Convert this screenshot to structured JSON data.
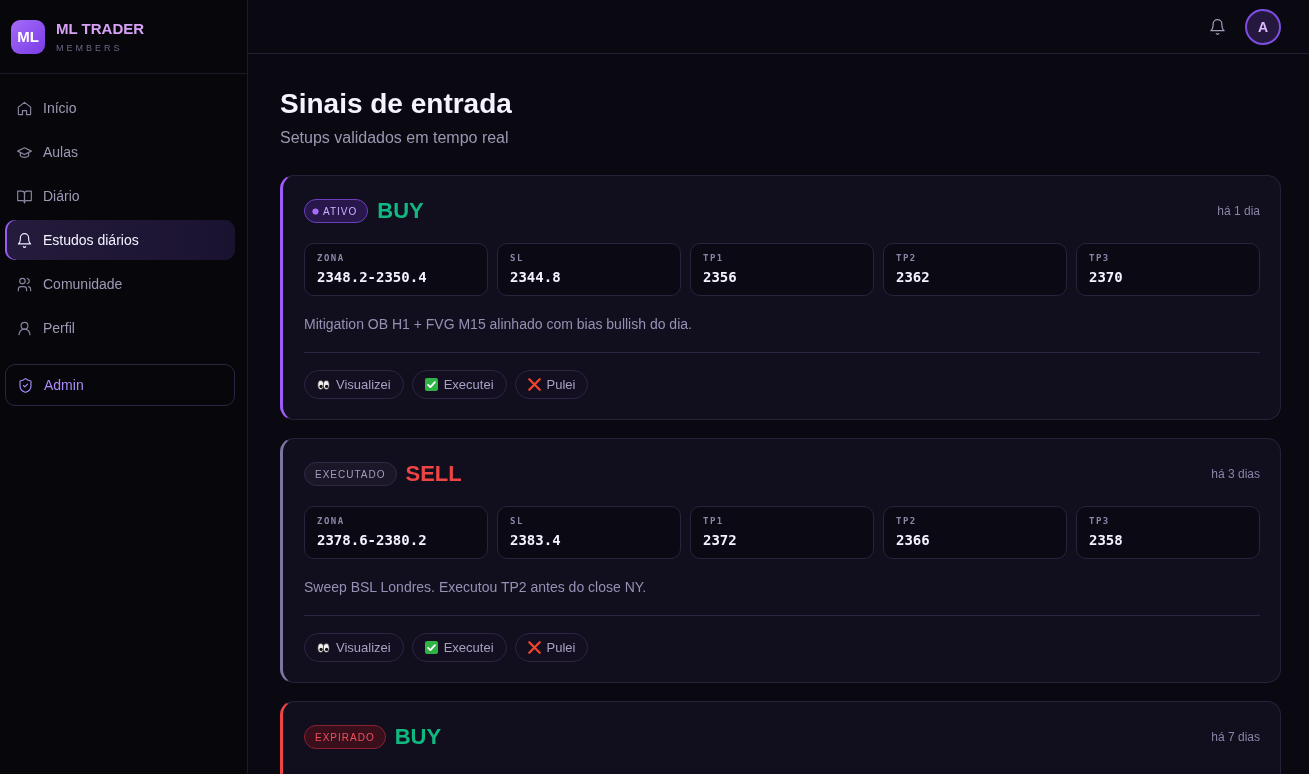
{
  "sidebar": {
    "brand": {
      "logo": "ML",
      "name": "ML TRADER",
      "tagline": "MEMBERS"
    },
    "items": [
      {
        "label": "Início",
        "selected": false
      },
      {
        "label": "Aulas",
        "selected": false
      },
      {
        "label": "Diário",
        "selected": false
      },
      {
        "label": "Estudos diários",
        "selected": true
      },
      {
        "label": "Comunidade",
        "selected": false
      },
      {
        "label": "Perfil",
        "selected": false
      }
    ],
    "admin": {
      "label": "Admin"
    }
  },
  "topbar": {
    "avatar": "A"
  },
  "page": {
    "title": "Sinais de entrada",
    "subtitle": "Setups validados em tempo real"
  },
  "signals": [
    {
      "status": {
        "label": "ATIVO",
        "kind": "active"
      },
      "direction": {
        "label": "BUY",
        "color": "#10b981"
      },
      "time": "há 1 dia",
      "metrics": [
        {
          "label": "ZONA",
          "value": "2348.2-2350.4"
        },
        {
          "label": "SL",
          "value": "2344.8"
        },
        {
          "label": "TP1",
          "value": "2356"
        },
        {
          "label": "TP2",
          "value": "2362"
        },
        {
          "label": "TP3",
          "value": "2370"
        }
      ],
      "description": "Mitigation OB H1 + FVG M15 alinhado com bias bullish do dia.",
      "actions": [
        {
          "label": "Visualizei",
          "kind": "view"
        },
        {
          "label": "Executei",
          "kind": "execute"
        },
        {
          "label": "Pulei",
          "kind": "skip"
        }
      ]
    },
    {
      "status": {
        "label": "EXECUTADO",
        "kind": "executed"
      },
      "direction": {
        "label": "SELL",
        "color": "#ef4444"
      },
      "time": "há 3 dias",
      "metrics": [
        {
          "label": "ZONA",
          "value": "2378.6-2380.2"
        },
        {
          "label": "SL",
          "value": "2383.4"
        },
        {
          "label": "TP1",
          "value": "2372"
        },
        {
          "label": "TP2",
          "value": "2366"
        },
        {
          "label": "TP3",
          "value": "2358"
        }
      ],
      "description": "Sweep BSL Londres. Executou TP2 antes do close NY.",
      "actions": [
        {
          "label": "Visualizei",
          "kind": "view"
        },
        {
          "label": "Executei",
          "kind": "execute"
        },
        {
          "label": "Pulei",
          "kind": "skip"
        }
      ]
    },
    {
      "status": {
        "label": "EXPIRADO",
        "kind": "expired"
      },
      "direction": {
        "label": "BUY",
        "color": "#10b981"
      },
      "time": "há 7 dias"
    }
  ]
}
